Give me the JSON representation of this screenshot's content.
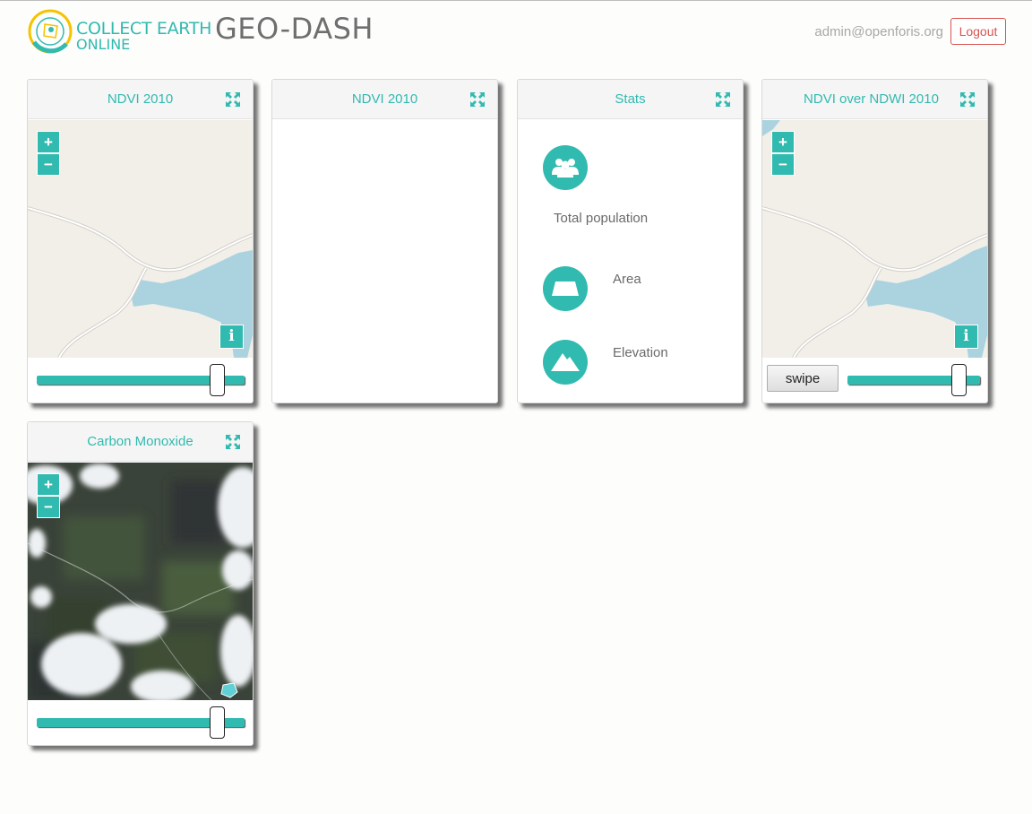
{
  "header": {
    "logo_line1": "COLLECT EARTH",
    "logo_line2": "ONLINE",
    "app_title": "GEO-DASH",
    "user_email": "admin@openforis.org",
    "logout_label": "Logout"
  },
  "colors": {
    "accent": "#31bab0",
    "logout": "#d9534f",
    "water": "#aad3df",
    "land": "#f2efe9"
  },
  "widgets": [
    {
      "title": "NDVI 2010",
      "type": "map",
      "zoom_in": "+",
      "zoom_out": "−",
      "info": "i",
      "opacity": 0.88
    },
    {
      "title": "NDVI 2010",
      "type": "empty"
    },
    {
      "title": "Stats",
      "type": "stats",
      "stats": [
        {
          "icon": "population-icon",
          "label": "Total population"
        },
        {
          "icon": "area-icon",
          "label": "Area"
        },
        {
          "icon": "elevation-icon",
          "label": "Elevation"
        }
      ]
    },
    {
      "title": "NDVI over NDWI 2010",
      "type": "swipe-map",
      "zoom_in": "+",
      "zoom_out": "−",
      "info": "i",
      "swipe_label": "swipe",
      "swipe_position": 0.85
    },
    {
      "title": "Carbon Monoxide",
      "type": "satellite-map",
      "zoom_in": "+",
      "zoom_out": "−",
      "opacity": 0.88
    }
  ]
}
